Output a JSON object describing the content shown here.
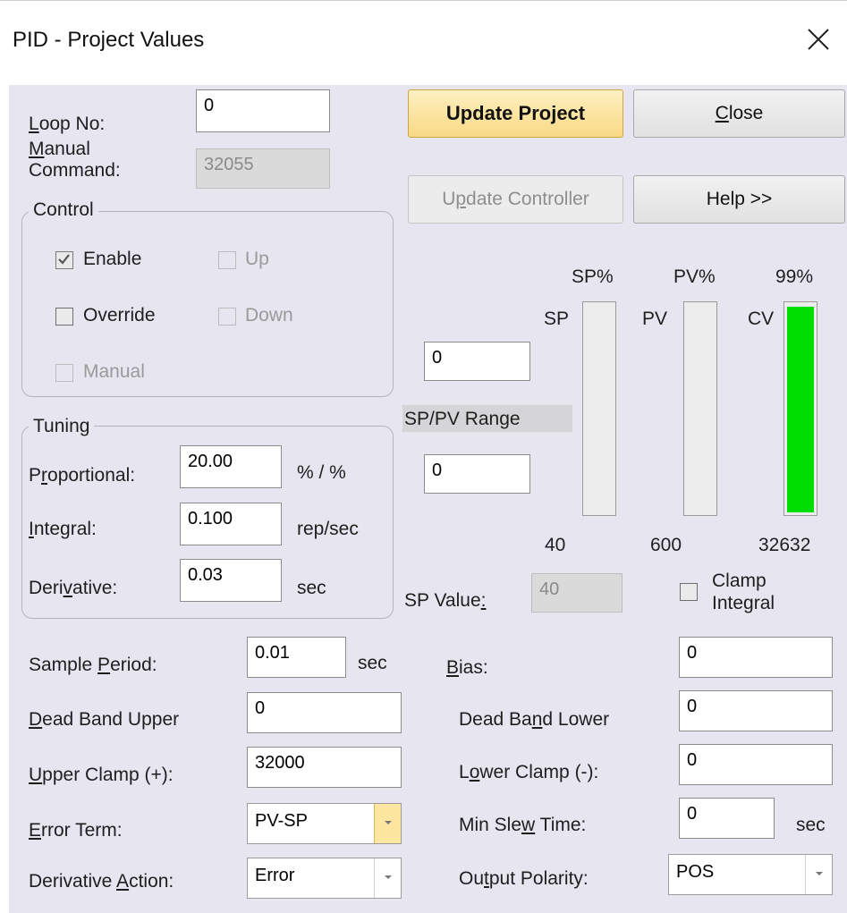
{
  "window": {
    "title": "PID - Project Values",
    "close_icon": "close-icon"
  },
  "loop_no": {
    "label_prefix": "",
    "label_ul": "L",
    "label_rest": "oop No:",
    "value": "0"
  },
  "manual_command": {
    "line1_ul": "M",
    "line1_rest": "anual",
    "line2": "Command:",
    "value": "32055"
  },
  "control": {
    "title": "Control",
    "enable": {
      "label": "Enable",
      "checked": true
    },
    "up": {
      "label": "Up"
    },
    "override": {
      "label": "Override"
    },
    "down": {
      "label": "Down"
    },
    "manual": {
      "label": "Manual"
    }
  },
  "tuning": {
    "title": "Tuning",
    "proportional": {
      "pre": "P",
      "ul": "r",
      "post": "oportional:",
      "value": "20.00",
      "unit": "% / %"
    },
    "integral": {
      "pre": "",
      "ul": "I",
      "post": "ntegral:",
      "value": "0.100",
      "unit": "rep/sec"
    },
    "derivative": {
      "pre": "Deri",
      "ul": "v",
      "post": "ative:",
      "value": "0.03",
      "unit": "sec"
    }
  },
  "buttons": {
    "update_project": "Update Project",
    "close": {
      "ul": "C",
      "rest": "lose"
    },
    "update_controller": {
      "pre": "U",
      "ul": "p",
      "post": "date Controller"
    },
    "help": "Help >>"
  },
  "sp_pv_range": {
    "label": "SP/PV Range",
    "upper": "0",
    "lower": "0"
  },
  "bars": {
    "sp": {
      "pct_label": "SP%",
      "label": "SP",
      "value": "40",
      "fill": 0
    },
    "pv": {
      "pct_label": "PV%",
      "label": "PV",
      "value": "600",
      "fill": 0
    },
    "cv": {
      "pct_label": "99%",
      "label": "CV",
      "value": "32632",
      "fill": 0.99,
      "color": "#00dd00"
    }
  },
  "sp_value": {
    "label_pre": "SP Value",
    "label_ul": ":",
    "value": "40"
  },
  "clamp_integral": {
    "line1": "Clamp",
    "line2": "Integral"
  },
  "sample_period": {
    "pre": "Sample ",
    "ul": "P",
    "post": "eriod:",
    "value": "0.01",
    "unit": "sec"
  },
  "bias": {
    "ul": "B",
    "post": "ias:",
    "value": "0"
  },
  "dead_band_upper": {
    "ul": "D",
    "post": "ead Band Upper",
    "value": "0"
  },
  "dead_band_lower": {
    "pre": "Dead Ba",
    "ul": "n",
    "post": "d Lower",
    "value": "0"
  },
  "upper_clamp": {
    "ul": "U",
    "post": "pper Clamp (+):",
    "value": "32000"
  },
  "lower_clamp": {
    "pre": "L",
    "ul": "o",
    "post": "wer Clamp  (-):",
    "value": "0"
  },
  "error_term": {
    "ul": "E",
    "post": "rror Term:",
    "value": "PV-SP"
  },
  "min_slew_time": {
    "pre": "Min Sle",
    "ul": "w",
    "post": " Time:",
    "value": "0",
    "unit": "sec"
  },
  "derivative_action": {
    "pre": "Derivative ",
    "ul": "A",
    "post": "ction:",
    "value": "Error"
  },
  "output_polarity": {
    "pre": "Ou",
    "ul": "t",
    "post": "put Polarity:",
    "value": "POS"
  }
}
